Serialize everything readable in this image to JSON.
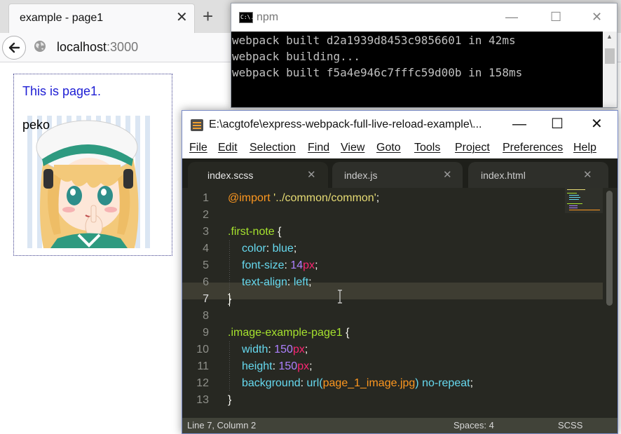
{
  "browser": {
    "tab_title": "example - page1",
    "tab_close_icon": "close-icon",
    "new_tab_icon": "plus-icon",
    "url_host": "localhost",
    "url_port": ":3000"
  },
  "page": {
    "first_note": "This is page1.",
    "peko": "peko"
  },
  "console": {
    "title": "npm",
    "icon_label": "C:\\.",
    "lines": [
      "webpack built d2a1939d8453c9856601 in 42ms",
      "webpack building...",
      "webpack built f5a4e946c7fffc59d00b in 158ms"
    ]
  },
  "sublime": {
    "title": "E:\\acgtofe\\express-webpack-full-live-reload-example\\...",
    "menu": [
      "File",
      "Edit",
      "Selection",
      "Find",
      "View",
      "Goto",
      "Tools",
      "Project",
      "Preferences",
      "Help"
    ],
    "tabs": [
      {
        "label": "index.scss",
        "active": true
      },
      {
        "label": "index.js",
        "active": false
      },
      {
        "label": "index.html",
        "active": false
      }
    ],
    "line_numbers": [
      "1",
      "2",
      "3",
      "4",
      "5",
      "6",
      "7",
      "8",
      "9",
      "10",
      "11",
      "12",
      "13"
    ],
    "code": {
      "l1_at": "@import",
      "l1_str": "'../common/common'",
      "l1_end": ";",
      "l3_sel": ".first-note",
      "l3_brace": " {",
      "l4_prop": "color",
      "l4_val": "blue",
      "l5_prop": "font-size",
      "l5_num": "14",
      "l5_unit": "px",
      "l6_prop": "text-align",
      "l6_val": "left",
      "l7_brace": "}",
      "l9_sel": ".image-example-page1",
      "l9_brace": " {",
      "l10_prop": "width",
      "l10_num": "150",
      "l10_unit": "px",
      "l11_prop": "height",
      "l11_num": "150",
      "l11_unit": "px",
      "l12_prop": "background",
      "l12_fn": "url(",
      "l12_arg": "page_1_image.jpg",
      "l12_close": ")",
      "l12_val": "no-repeat",
      "l13_brace": "}",
      "colon": ": ",
      "semi": ";"
    },
    "status": {
      "position": "Line 7, Column 2",
      "spaces": "Spaces: 4",
      "syntax": "SCSS"
    }
  },
  "colors": {
    "browser_chrome": "#dfdfdf",
    "first_note_text": "#1d1dd4",
    "editor_bg": "#272822",
    "console_bg": "#000000"
  }
}
